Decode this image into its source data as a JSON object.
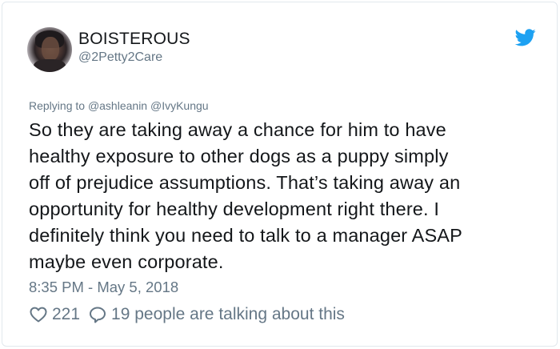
{
  "author": {
    "display_name": "BOISTEROUS",
    "handle": "@2Petty2Care"
  },
  "reply": {
    "prefix": "Replying to",
    "mentions": [
      "@ashleanin",
      "@IvyKungu"
    ]
  },
  "tweet": {
    "lines": [
      "So they are taking away a chance for him to have",
      "healthy exposure to other dogs as a puppy simply",
      "off of prejudice assumptions. That’s taking away an",
      "opportunity for healthy development right there. I",
      "definitely think you need to talk to a manager ASAP",
      "maybe even corporate."
    ],
    "timestamp": "8:35 PM - May 5, 2018"
  },
  "stats": {
    "likes": "221",
    "talking": "19 people are talking about this"
  },
  "icons": {
    "brand": "twitter-bird-icon",
    "like": "heart-icon",
    "reply": "speech-bubble-icon"
  },
  "colors": {
    "brand": "#1da1f2",
    "text": "#14171a",
    "secondary": "#657786",
    "border": "#e1e8ed"
  }
}
